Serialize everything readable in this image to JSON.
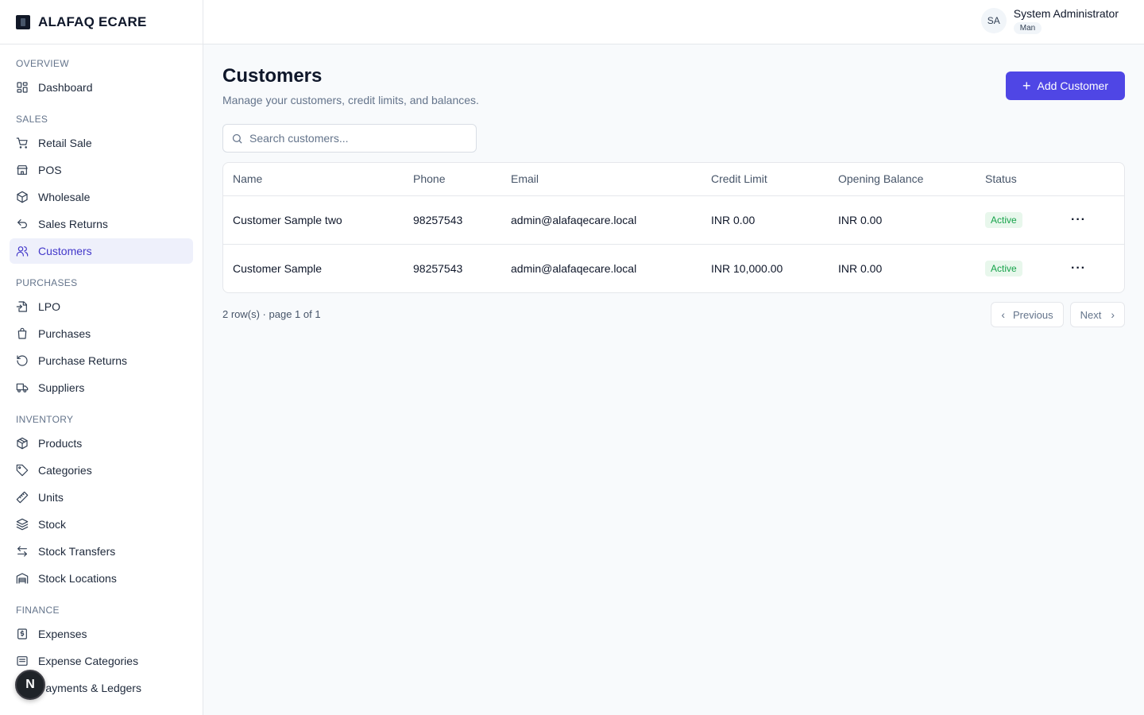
{
  "brand": {
    "name": "ALAFAQ ECARE"
  },
  "user": {
    "initials": "SA",
    "name": "System Administrator",
    "role": "Man"
  },
  "sidebar": {
    "sections": [
      {
        "title": "OVERVIEW",
        "items": [
          {
            "label": "Dashboard",
            "icon": "dashboard-icon"
          }
        ]
      },
      {
        "title": "SALES",
        "items": [
          {
            "label": "Retail Sale",
            "icon": "cart-icon"
          },
          {
            "label": "POS",
            "icon": "store-icon"
          },
          {
            "label": "Wholesale",
            "icon": "boxes-icon"
          },
          {
            "label": "Sales Returns",
            "icon": "undo-icon"
          },
          {
            "label": "Customers",
            "icon": "users-icon",
            "active": true
          }
        ]
      },
      {
        "title": "PURCHASES",
        "items": [
          {
            "label": "LPO",
            "icon": "file-import-icon"
          },
          {
            "label": "Purchases",
            "icon": "shopping-bag-icon"
          },
          {
            "label": "Purchase Returns",
            "icon": "rotate-ccw-icon"
          },
          {
            "label": "Suppliers",
            "icon": "truck-icon"
          }
        ]
      },
      {
        "title": "INVENTORY",
        "items": [
          {
            "label": "Products",
            "icon": "package-icon"
          },
          {
            "label": "Categories",
            "icon": "tag-icon"
          },
          {
            "label": "Units",
            "icon": "ruler-icon"
          },
          {
            "label": "Stock",
            "icon": "layers-icon"
          },
          {
            "label": "Stock Transfers",
            "icon": "arrow-left-right-icon"
          },
          {
            "label": "Stock Locations",
            "icon": "warehouse-icon"
          }
        ]
      },
      {
        "title": "FINANCE",
        "items": [
          {
            "label": "Expenses",
            "icon": "receipt-icon"
          },
          {
            "label": "Expense Categories",
            "icon": "list-icon"
          },
          {
            "label": "Payments & Ledgers",
            "icon": "wallet-icon"
          }
        ]
      }
    ]
  },
  "fab": {
    "label": "N"
  },
  "page": {
    "title": "Customers",
    "subtitle": "Manage your customers, credit limits, and balances.",
    "add_button": "Add Customer",
    "search_placeholder": "Search customers..."
  },
  "table": {
    "columns": [
      "Name",
      "Phone",
      "Email",
      "Credit Limit",
      "Opening Balance",
      "Status"
    ],
    "rows": [
      {
        "name": "Customer Sample two",
        "phone": "98257543",
        "email": "admin@alafaqecare.local",
        "credit_limit": "INR 0.00",
        "opening_balance": "INR 0.00",
        "status": "Active"
      },
      {
        "name": "Customer Sample",
        "phone": "98257543",
        "email": "admin@alafaqecare.local",
        "credit_limit": "INR 10,000.00",
        "opening_balance": "INR 0.00",
        "status": "Active"
      }
    ]
  },
  "pagination": {
    "info": "2 row(s) · page 1 of 1",
    "previous": "Previous",
    "next": "Next"
  },
  "colors": {
    "accent": "#4f46e5",
    "active_nav_bg": "#eef0fb",
    "status_active_bg": "#e8f7ec",
    "status_active_text": "#16a34a"
  }
}
